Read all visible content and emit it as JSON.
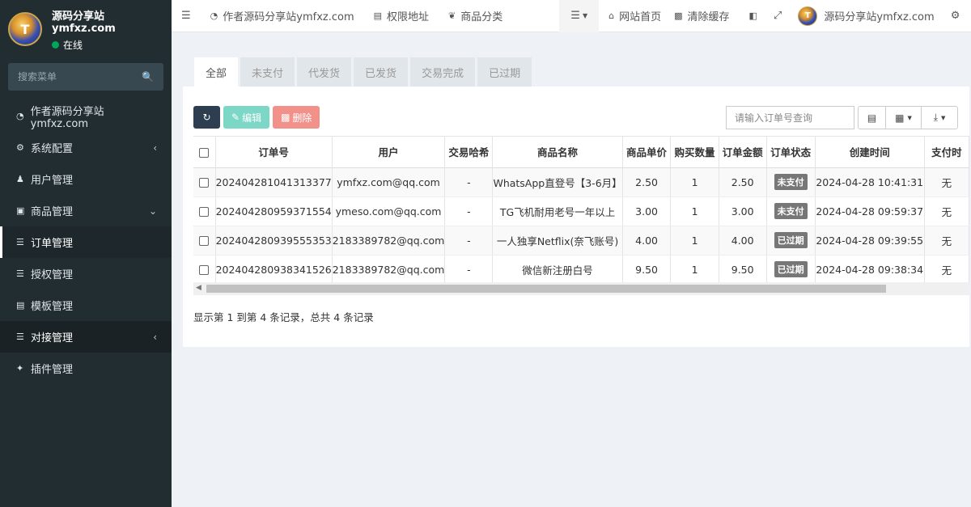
{
  "sidebar": {
    "user_name": "源码分享站ymfxz.com",
    "status": "在线",
    "search_placeholder": "搜索菜单",
    "items": [
      {
        "label": "作者源码分享站ymfxz.com",
        "icon": "dashboard-icon"
      },
      {
        "label": "系统配置",
        "icon": "gear-icon"
      },
      {
        "label": "用户管理",
        "icon": "user-icon"
      },
      {
        "label": "商品管理",
        "icon": "cart-icon"
      },
      {
        "label": "订单管理",
        "icon": "list-icon"
      },
      {
        "label": "授权管理",
        "icon": "list-icon"
      },
      {
        "label": "模板管理",
        "icon": "template-icon"
      },
      {
        "label": "对接管理",
        "icon": "sliders-icon"
      },
      {
        "label": "插件管理",
        "icon": "plugin-icon"
      }
    ]
  },
  "topbar": {
    "nav1": "作者源码分享站ymfxz.com",
    "nav2": "权限地址",
    "nav3": "商品分类",
    "home": "网站首页",
    "clear_cache": "清除缓存",
    "user_name": "源码分享站ymfxz.com"
  },
  "tabs": [
    "全部",
    "未支付",
    "代发货",
    "已发货",
    "交易完成",
    "已过期"
  ],
  "toolbar": {
    "edit": "编辑",
    "delete": "删除",
    "search_placeholder": "请输入订单号查询"
  },
  "table": {
    "columns": [
      "订单号",
      "用户",
      "交易哈希",
      "商品名称",
      "商品单价",
      "购买数量",
      "订单金额",
      "订单状态",
      "创建时间",
      "支付时"
    ],
    "rows": [
      [
        "202404281041313377",
        "ymfxz.com@qq.com",
        "-",
        "WhatsApp直登号【3-6月】",
        "2.50",
        "1",
        "2.50",
        "未支付",
        "2024-04-28 10:41:31",
        "无"
      ],
      [
        "202404280959371554",
        "ymeso.com@qq.com",
        "-",
        "TG飞机耐用老号一年以上",
        "3.00",
        "1",
        "3.00",
        "未支付",
        "2024-04-28 09:59:37",
        "无"
      ],
      [
        "202404280939555353",
        "2183389782@qq.com",
        "-",
        "一人独享Netflix(奈飞账号)",
        "4.00",
        "1",
        "4.00",
        "已过期",
        "2024-04-28 09:39:55",
        "无"
      ],
      [
        "202404280938341526",
        "2183389782@qq.com",
        "-",
        "微信新注册白号",
        "9.50",
        "1",
        "9.50",
        "已过期",
        "2024-04-28 09:38:34",
        "无"
      ]
    ]
  },
  "summary": "显示第 1 到第 4 条记录，总共 4 条记录"
}
